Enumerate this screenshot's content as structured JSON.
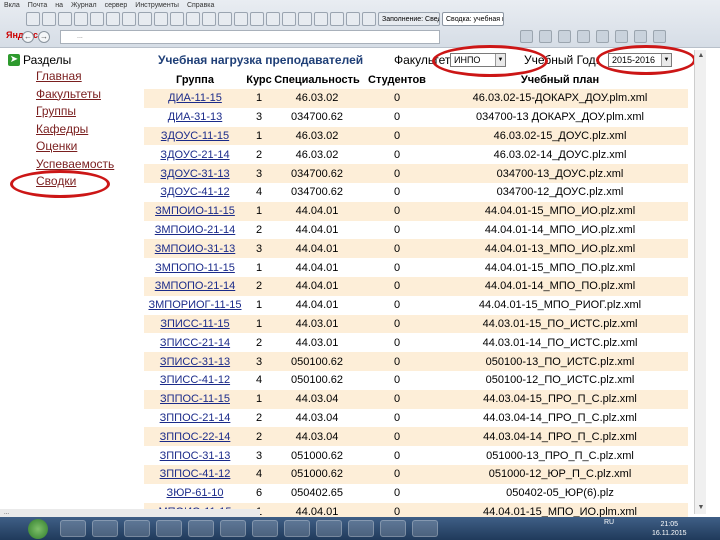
{
  "browser": {
    "menu": [
      "Вкла",
      "Почта",
      "на",
      "Журнал",
      "сервер",
      "Инструменты",
      "Справка"
    ],
    "tabs": [
      "",
      "",
      "",
      "",
      "",
      "",
      "",
      "",
      "",
      "",
      "",
      "",
      "",
      "",
      "",
      "",
      "",
      "",
      "",
      "",
      "",
      ""
    ],
    "active_tab": "Сводка: учебная группа",
    "prev_tab": "Заполнение: Сведе...",
    "logo": "Яндекс",
    "address": "..."
  },
  "nav": {
    "heading": "Разделы",
    "items": [
      {
        "label": "Главная"
      },
      {
        "label": "Факультеты"
      },
      {
        "label": "Группы"
      },
      {
        "label": "Кафедры"
      },
      {
        "label": "Оценки"
      },
      {
        "label": "Успеваемость"
      },
      {
        "label": "Сводки"
      }
    ]
  },
  "header": {
    "title": "Учебная нагрузка преподавателей",
    "faculty_label": "Факультет:",
    "faculty_value": "ИНПО",
    "year_label": "Учебный Год:",
    "year_value": "2015-2016"
  },
  "table": {
    "columns": [
      "Группа",
      "Курс",
      "Специальность",
      "Студентов",
      "Учебный план"
    ],
    "rows": [
      [
        "ДИА-11-15",
        "1",
        "46.03.02",
        "0",
        "46.03.02-15-ДОКАРХ_ДОУ.plm.xml"
      ],
      [
        "ДИА-31-13",
        "3",
        "034700.62",
        "0",
        "034700-13 ДОКАРХ_ДОУ.plm.xml"
      ],
      [
        "ЗДОУС-11-15",
        "1",
        "46.03.02",
        "0",
        "46.03.02-15_ДОУС.plz.xml"
      ],
      [
        "ЗДОУС-21-14",
        "2",
        "46.03.02",
        "0",
        "46.03.02-14_ДОУС.plz.xml"
      ],
      [
        "ЗДОУС-31-13",
        "3",
        "034700.62",
        "0",
        "034700-13_ДОУС.plz.xml"
      ],
      [
        "ЗДОУС-41-12",
        "4",
        "034700.62",
        "0",
        "034700-12_ДОУС.plz.xml"
      ],
      [
        "ЗМПОИО-11-15",
        "1",
        "44.04.01",
        "0",
        "44.04.01-15_МПО_ИО.plz.xml"
      ],
      [
        "ЗМПОИО-21-14",
        "2",
        "44.04.01",
        "0",
        "44.04.01-14_МПО_ИО.plz.xml"
      ],
      [
        "ЗМПОИО-31-13",
        "3",
        "44.04.01",
        "0",
        "44.04.01-13_МПО_ИО.plz.xml"
      ],
      [
        "ЗМПОПО-11-15",
        "1",
        "44.04.01",
        "0",
        "44.04.01-15_МПО_ПО.plz.xml"
      ],
      [
        "ЗМПОПО-21-14",
        "2",
        "44.04.01",
        "0",
        "44.04.01-14_МПО_ПО.plz.xml"
      ],
      [
        "ЗМПОРИОГ-11-15",
        "1",
        "44.04.01",
        "0",
        "44.04.01-15_МПО_РИОГ.plz.xml"
      ],
      [
        "ЗПИСС-11-15",
        "1",
        "44.03.01",
        "0",
        "44.03.01-15_ПО_ИСТС.plz.xml"
      ],
      [
        "ЗПИСС-21-14",
        "2",
        "44.03.01",
        "0",
        "44.03.01-14_ПО_ИСТС.plz.xml"
      ],
      [
        "ЗПИСС-31-13",
        "3",
        "050100.62",
        "0",
        "050100-13_ПО_ИСТС.plz.xml"
      ],
      [
        "ЗПИСС-41-12",
        "4",
        "050100.62",
        "0",
        "050100-12_ПО_ИСТС.plz.xml"
      ],
      [
        "ЗППОС-11-15",
        "1",
        "44.03.04",
        "0",
        "44.03.04-15_ПРО_П_С.plz.xml"
      ],
      [
        "ЗППОС-21-14",
        "2",
        "44.03.04",
        "0",
        "44.03.04-14_ПРО_П_С.plz.xml"
      ],
      [
        "ЗППОС-22-14",
        "2",
        "44.03.04",
        "0",
        "44.03.04-14_ПРО_П_С.plz.xml"
      ],
      [
        "ЗППОС-31-13",
        "3",
        "051000.62",
        "0",
        "051000-13_ПРО_П_С.plz.xml"
      ],
      [
        "ЗППОС-41-12",
        "4",
        "051000.62",
        "0",
        "051000-12_ЮР_П_С.plz.xml"
      ],
      [
        "ЗЮР-61-10",
        "6",
        "050402.65",
        "0",
        "050402-05_ЮР(6).plz"
      ],
      [
        "МПОИО-11-15",
        "1",
        "44.04.01",
        "0",
        "44.04.01-15_МПО_ИО.plm.xml"
      ]
    ]
  },
  "status_bar": {
    "text": "..."
  },
  "taskbar": {
    "tray_lang": "RU",
    "time": "21:05",
    "date": "16.11.2015"
  },
  "colors": {
    "row_alt": "#fdeed8",
    "link": "#1b2b8a",
    "nav_link": "#7a1f1f",
    "title": "#1f3f77",
    "highlight_ring": "#cc1616"
  }
}
